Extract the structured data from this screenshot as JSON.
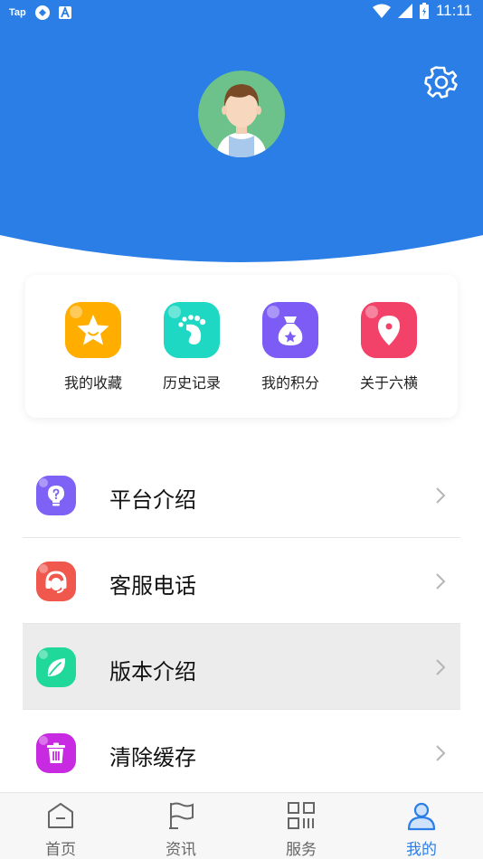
{
  "status_bar": {
    "left_label": "Tap",
    "time": "11:11"
  },
  "header": {
    "background_color": "#2b7ee6",
    "avatar_icon": "boy-avatar",
    "settings_icon": "gear-icon"
  },
  "quick_actions": [
    {
      "label": "我的收藏",
      "icon": "star-icon",
      "color": "#ffae00"
    },
    {
      "label": "历史记录",
      "icon": "footprint-icon",
      "color": "#1fd8c4"
    },
    {
      "label": "我的积分",
      "icon": "money-bag-icon",
      "color": "#7d5cf5"
    },
    {
      "label": "关于六横",
      "icon": "location-pin-icon",
      "color": "#f2426a"
    }
  ],
  "menu": [
    {
      "label": "平台介绍",
      "icon": "lightbulb-icon",
      "color": "#7e61f5"
    },
    {
      "label": "客服电话",
      "icon": "headset-icon",
      "color": "#f0574d"
    },
    {
      "label": "版本介绍",
      "icon": "leaf-icon",
      "color": "#1fd89a"
    },
    {
      "label": "清除缓存",
      "icon": "trash-icon",
      "color": "#c72ae0"
    }
  ],
  "bottom_nav": [
    {
      "label": "首页",
      "icon": "home-icon"
    },
    {
      "label": "资讯",
      "icon": "flag-icon"
    },
    {
      "label": "服务",
      "icon": "grid-icon"
    },
    {
      "label": "我的",
      "icon": "user-icon"
    }
  ],
  "active_tab": "我的",
  "accent_color": "#2b7ee6"
}
